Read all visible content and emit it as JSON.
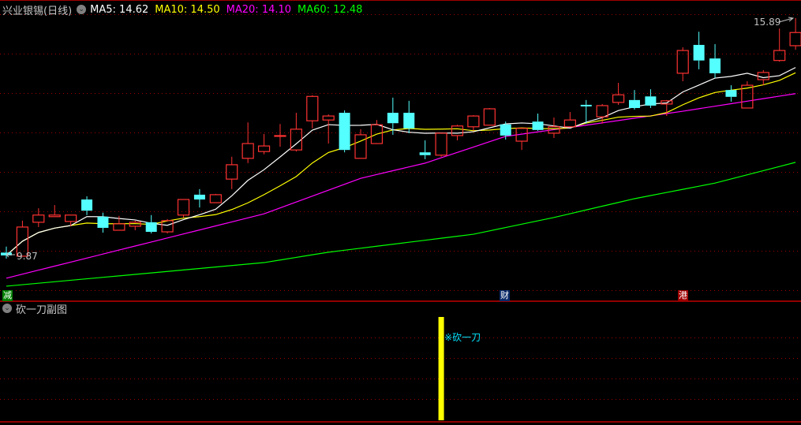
{
  "header": {
    "title": "兴业银锡(日线)",
    "ma_labels": [
      {
        "text": "MA5: 14.62",
        "color": "#ffffff"
      },
      {
        "text": "MA10: 14.50",
        "color": "#ffff00"
      },
      {
        "text": "MA20: 14.10",
        "color": "#ff00ff"
      },
      {
        "text": "MA60: 12.48",
        "color": "#00ff00"
      }
    ]
  },
  "sub_panel": {
    "title": "砍一刀副图"
  },
  "markers": [
    {
      "index": 0,
      "text": "减",
      "bg": "#008000"
    },
    {
      "index": 31,
      "text": "财",
      "bg": "#0a2a6a"
    },
    {
      "index": 42,
      "text": "港",
      "bg": "#a00000"
    }
  ],
  "colors": {
    "up": "#ff3232",
    "down": "#54ffff",
    "grid": "#a00000",
    "ma5": "#ffffff",
    "ma10": "#ffff00",
    "ma20": "#ff00ff",
    "ma60": "#00ff00",
    "signal": "#ffff00",
    "signal_text": "#00e5ff"
  },
  "chart_data": {
    "type": "candlestick",
    "high_label": "15.89",
    "low_label": "9.87",
    "candles_ohlc": [
      [
        10.02,
        10.17,
        9.87,
        9.95
      ],
      [
        9.93,
        10.82,
        9.93,
        10.66
      ],
      [
        10.78,
        11.13,
        10.66,
        10.96
      ],
      [
        10.92,
        11.21,
        10.92,
        10.96
      ],
      [
        10.8,
        10.96,
        10.68,
        10.96
      ],
      [
        11.35,
        11.43,
        10.96,
        11.07
      ],
      [
        10.92,
        11.02,
        10.52,
        10.64
      ],
      [
        10.58,
        10.94,
        10.58,
        10.74
      ],
      [
        10.68,
        10.82,
        10.58,
        10.78
      ],
      [
        10.78,
        10.96,
        10.5,
        10.54
      ],
      [
        10.54,
        10.86,
        10.5,
        10.82
      ],
      [
        10.96,
        11.35,
        10.9,
        11.35
      ],
      [
        11.47,
        11.61,
        11.15,
        11.35
      ],
      [
        11.27,
        11.49,
        11.27,
        11.47
      ],
      [
        11.86,
        12.42,
        11.61,
        12.22
      ],
      [
        12.38,
        13.28,
        12.26,
        12.75
      ],
      [
        12.55,
        12.99,
        12.48,
        12.69
      ],
      [
        12.93,
        13.24,
        12.67,
        12.95
      ],
      [
        12.59,
        13.52,
        12.55,
        13.11
      ],
      [
        13.32,
        13.96,
        13.13,
        13.93
      ],
      [
        13.34,
        13.48,
        12.75,
        13.44
      ],
      [
        13.52,
        13.58,
        12.53,
        12.59
      ],
      [
        12.38,
        13.11,
        12.38,
        12.97
      ],
      [
        12.75,
        13.34,
        12.75,
        13.22
      ],
      [
        13.52,
        13.9,
        12.97,
        13.26
      ],
      [
        13.52,
        13.82,
        13.01,
        13.13
      ],
      [
        12.53,
        12.83,
        12.36,
        12.46
      ],
      [
        12.46,
        13.01,
        12.42,
        13.01
      ],
      [
        12.95,
        13.22,
        12.83,
        13.19
      ],
      [
        13.17,
        13.46,
        13.07,
        13.44
      ],
      [
        13.21,
        13.64,
        13.21,
        13.62
      ],
      [
        13.23,
        13.3,
        12.85,
        12.95
      ],
      [
        12.81,
        13.13,
        12.59,
        13.13
      ],
      [
        13.3,
        13.5,
        13.07,
        13.09
      ],
      [
        13.01,
        13.4,
        12.89,
        13.17
      ],
      [
        13.17,
        13.54,
        13.17,
        13.34
      ],
      [
        13.72,
        13.84,
        13.25,
        13.7
      ],
      [
        13.42,
        13.74,
        13.25,
        13.7
      ],
      [
        13.78,
        14.27,
        13.72,
        13.97
      ],
      [
        13.84,
        14.09,
        13.6,
        13.64
      ],
      [
        13.93,
        14.11,
        13.64,
        13.7
      ],
      [
        13.74,
        13.84,
        13.44,
        13.82
      ],
      [
        14.51,
        15.16,
        14.31,
        15.08
      ],
      [
        15.22,
        15.55,
        14.61,
        14.83
      ],
      [
        14.88,
        15.24,
        14.39,
        14.51
      ],
      [
        14.09,
        14.21,
        13.8,
        13.92
      ],
      [
        13.64,
        14.31,
        13.64,
        14.21
      ],
      [
        14.35,
        14.59,
        14.21,
        14.53
      ],
      [
        14.83,
        15.63,
        14.8,
        15.08
      ],
      [
        15.2,
        15.89,
        15.1,
        15.53
      ]
    ],
    "ma20_samples": [
      [
        0,
        9.38
      ],
      [
        16,
        10.99
      ],
      [
        22,
        11.88
      ],
      [
        26,
        12.26
      ],
      [
        31,
        12.93
      ],
      [
        36,
        13.21
      ],
      [
        42,
        13.56
      ],
      [
        49,
        14.0
      ]
    ],
    "ma60_samples": [
      [
        0,
        9.18
      ],
      [
        16,
        9.77
      ],
      [
        20,
        10.03
      ],
      [
        29,
        10.48
      ],
      [
        34,
        10.9
      ],
      [
        39,
        11.37
      ],
      [
        44,
        11.76
      ],
      [
        49,
        12.28
      ]
    ],
    "signal": {
      "index": 27,
      "label": "※砍一刀"
    }
  }
}
